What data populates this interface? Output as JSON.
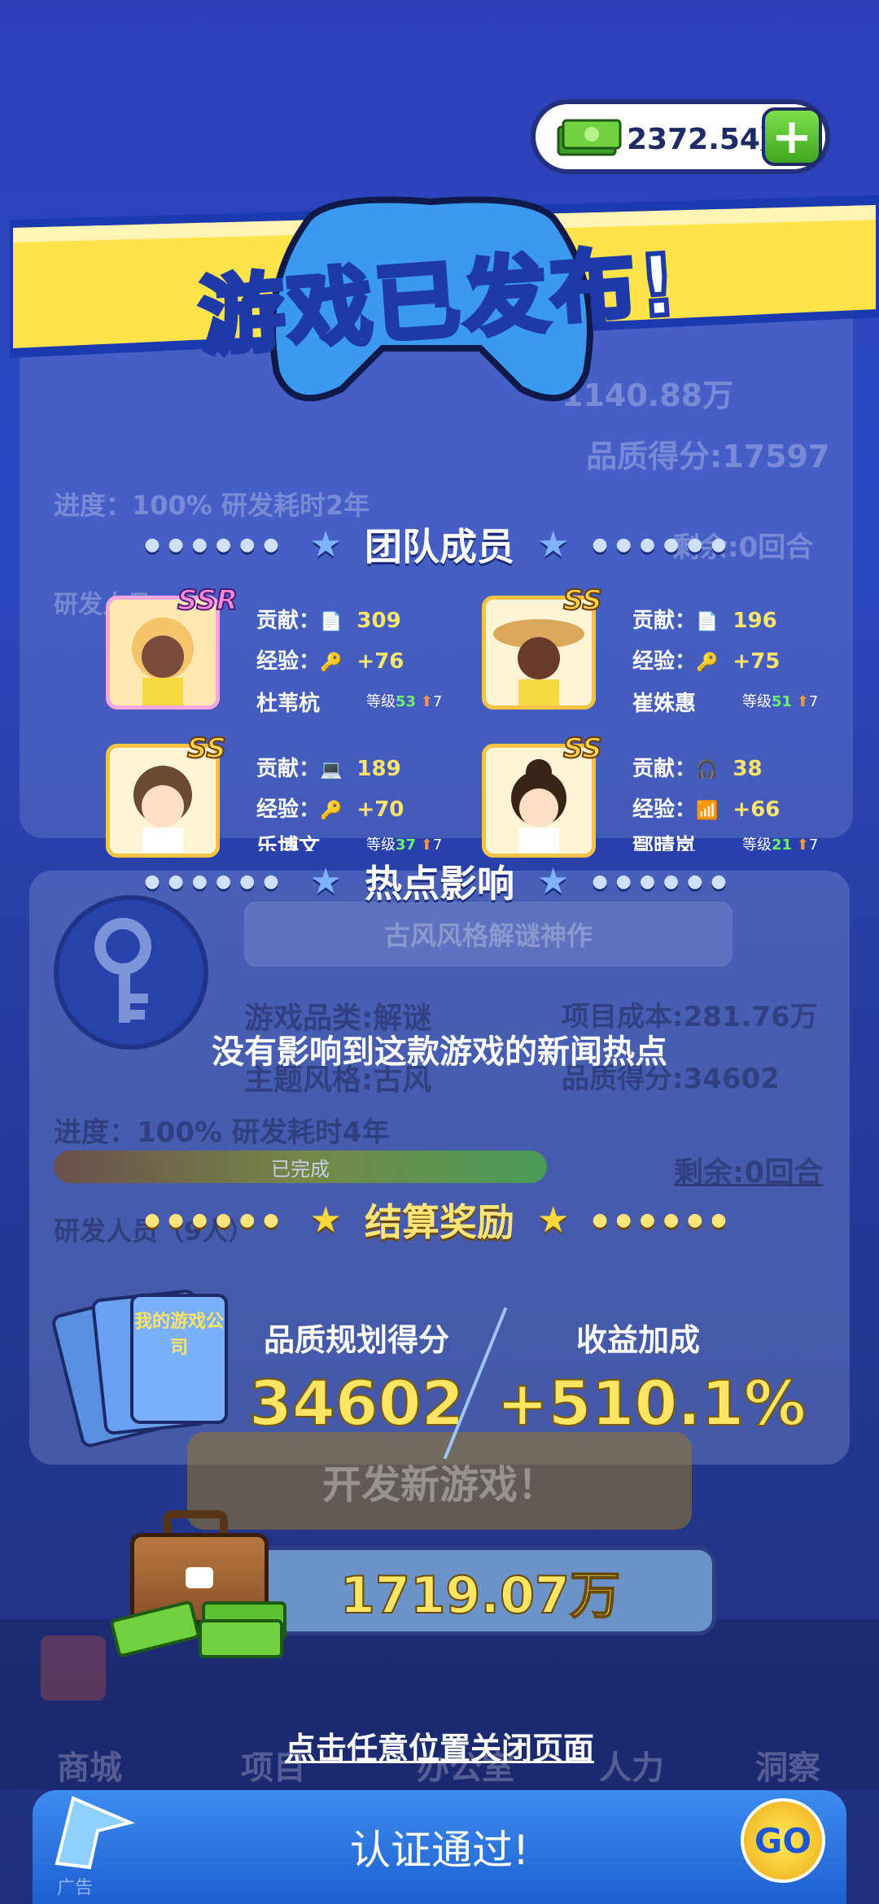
{
  "money": {
    "amount": "2372.54万",
    "plus_icon": "plus-icon"
  },
  "banner": {
    "title": "游戏已发布!"
  },
  "background": {
    "cost_top": "1140.88万",
    "quality_top": "品质得分:17597",
    "progress_top": "进度：100% 研发耗时2年",
    "remaining_top": "剩余:0回合",
    "rd_staff_top": "研发人员",
    "hot_name": "古风风格解谜神作",
    "category": "游戏品类:解谜",
    "theme": "主题风格:古风",
    "project_cost": "项目成本:281.76万",
    "quality": "品质得分:34602",
    "progress": "进度：100% 研发耗时4年",
    "progress_status": "已完成",
    "remaining": "剩余:0回合",
    "staff_count": "研发人员（9人）",
    "new_game_button": "开发新游戏！",
    "nav": [
      "商城",
      "项目",
      "办公室",
      "人力",
      "洞察"
    ]
  },
  "team": {
    "header": "团队成员",
    "contrib_label": "贡献：",
    "exp_label": "经验：",
    "level_label": "等级",
    "members": [
      {
        "rank": "SSR",
        "contribution": "309",
        "exp": "+76",
        "name": "杜苇杭",
        "level": "53",
        "level_up": "7"
      },
      {
        "rank": "SS",
        "contribution": "196",
        "exp": "+75",
        "name": "崔姝惠",
        "level": "51",
        "level_up": "7"
      },
      {
        "rank": "SS",
        "contribution": "189",
        "exp": "+70",
        "name": "乐博文",
        "level": "37",
        "level_up": "7"
      },
      {
        "rank": "SS",
        "contribution": "38",
        "exp": "+66",
        "name": "鄢晴岚",
        "level": "21",
        "level_up": "7"
      }
    ]
  },
  "hot": {
    "header": "热点影响",
    "message": "没有影响到这款游戏的新闻热点"
  },
  "reward": {
    "header": "结算奖励",
    "card_text": "我的游戏公司",
    "quality_label": "品质规划得分",
    "quality_value": "34602",
    "bonus_label": "收益加成",
    "bonus_value": "+510.1%",
    "amount": "1719.07万"
  },
  "close_hint": "点击任意位置关闭页面",
  "footer": {
    "text": "认证通过!",
    "go": "GO",
    "ad": "广告"
  },
  "colors": {
    "gold": "#ffe563",
    "accent_blue": "#2b48c4",
    "green": "#6ef06a"
  }
}
